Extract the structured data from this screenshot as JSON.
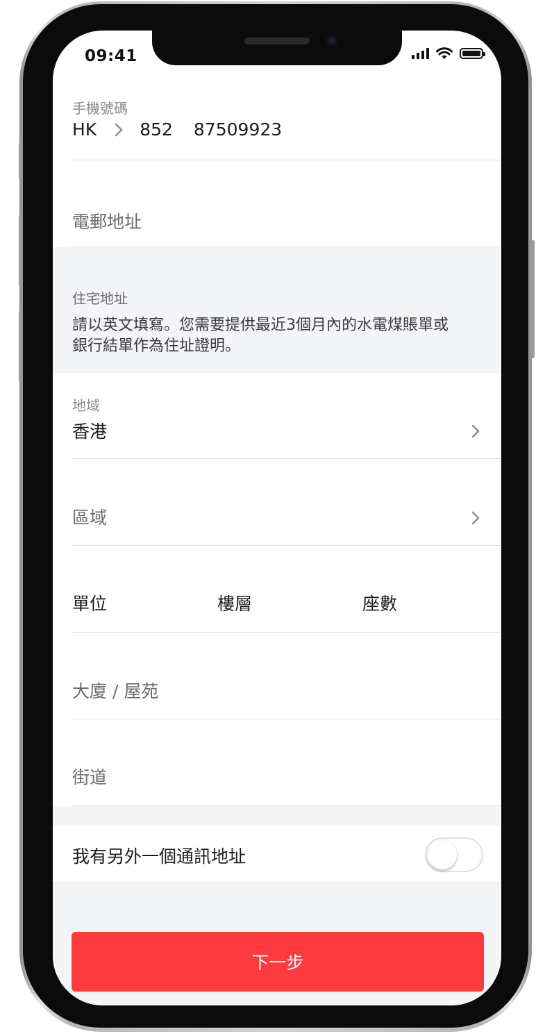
{
  "status_bar": {
    "time": "09:41"
  },
  "phone": {
    "label": "手機號碼",
    "country": "HK",
    "code": "852",
    "number": "87509923"
  },
  "email": {
    "placeholder": "電郵地址"
  },
  "address_section": {
    "title": "住宅地址",
    "note_line1": "請以英文填寫。您需要提供最近3個月內的水電煤賬單或",
    "note_line2": "銀行結單作為住址證明。"
  },
  "region": {
    "label": "地域",
    "value": "香港"
  },
  "district": {
    "placeholder": "區域"
  },
  "unit_fields": {
    "unit": "單位",
    "floor": "樓層",
    "block": "座數"
  },
  "building": {
    "placeholder": "大廈 / 屋苑"
  },
  "street": {
    "placeholder": "街道"
  },
  "mailing_toggle": {
    "label": "我有另外一個通訊地址",
    "on": false
  },
  "next_button": {
    "label": "下一步"
  },
  "icons": [
    "chevron-right-icon",
    "signal-icon",
    "wifi-icon",
    "battery-icon"
  ],
  "colors": {
    "accent": "#fd3b3f",
    "section_bg": "#f4f5f7",
    "secondary_text": "#8e8e93"
  }
}
